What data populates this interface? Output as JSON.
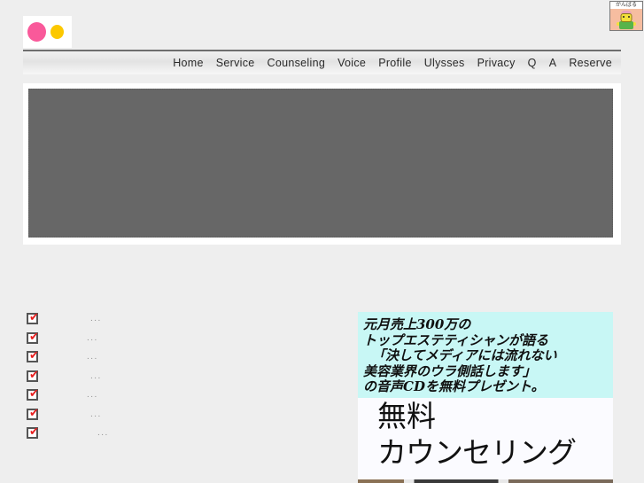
{
  "header": {
    "logo": {
      "name": "site-logo",
      "pink_dot_color": "#f9599a",
      "yellow_dot_color": "#fcc800"
    },
    "corner_badge": {
      "caption": "がんばる",
      "background_color": "#f6bda0"
    }
  },
  "nav": {
    "items": [
      {
        "label": "Home"
      },
      {
        "label": "Service"
      },
      {
        "label": "Counseling"
      },
      {
        "label": "Voice"
      },
      {
        "label": "Profile"
      },
      {
        "label": "Ulysses"
      },
      {
        "label": "Privacy"
      },
      {
        "label": "Q"
      },
      {
        "label": "A"
      },
      {
        "label": "Reserve"
      }
    ]
  },
  "hero": {
    "placeholder_color": "#676767"
  },
  "checklist": {
    "items": [
      {
        "mark": "✔",
        "text": "...",
        "indent": 72
      },
      {
        "mark": "✔",
        "text": "...",
        "indent": 68
      },
      {
        "mark": "✔",
        "text": "...",
        "indent": 68
      },
      {
        "mark": "✔",
        "text": "...",
        "indent": 72
      },
      {
        "mark": "✔",
        "text": "...",
        "indent": 68
      },
      {
        "mark": "✔",
        "text": "...",
        "indent": 72
      },
      {
        "mark": "✔",
        "text": "...",
        "indent": 80
      }
    ]
  },
  "promo": {
    "background_top": "#c8f7f5",
    "background_bottom": "#fbfbff",
    "lines": [
      "元月売上300万の",
      "トップエステティシャンが語る",
      "「決してメディアには流れない",
      "美容業界のウラ側話します」",
      "の音声CDを無料プレゼント。"
    ],
    "free_label": "無料",
    "counseling_label": "カウンセリング"
  }
}
